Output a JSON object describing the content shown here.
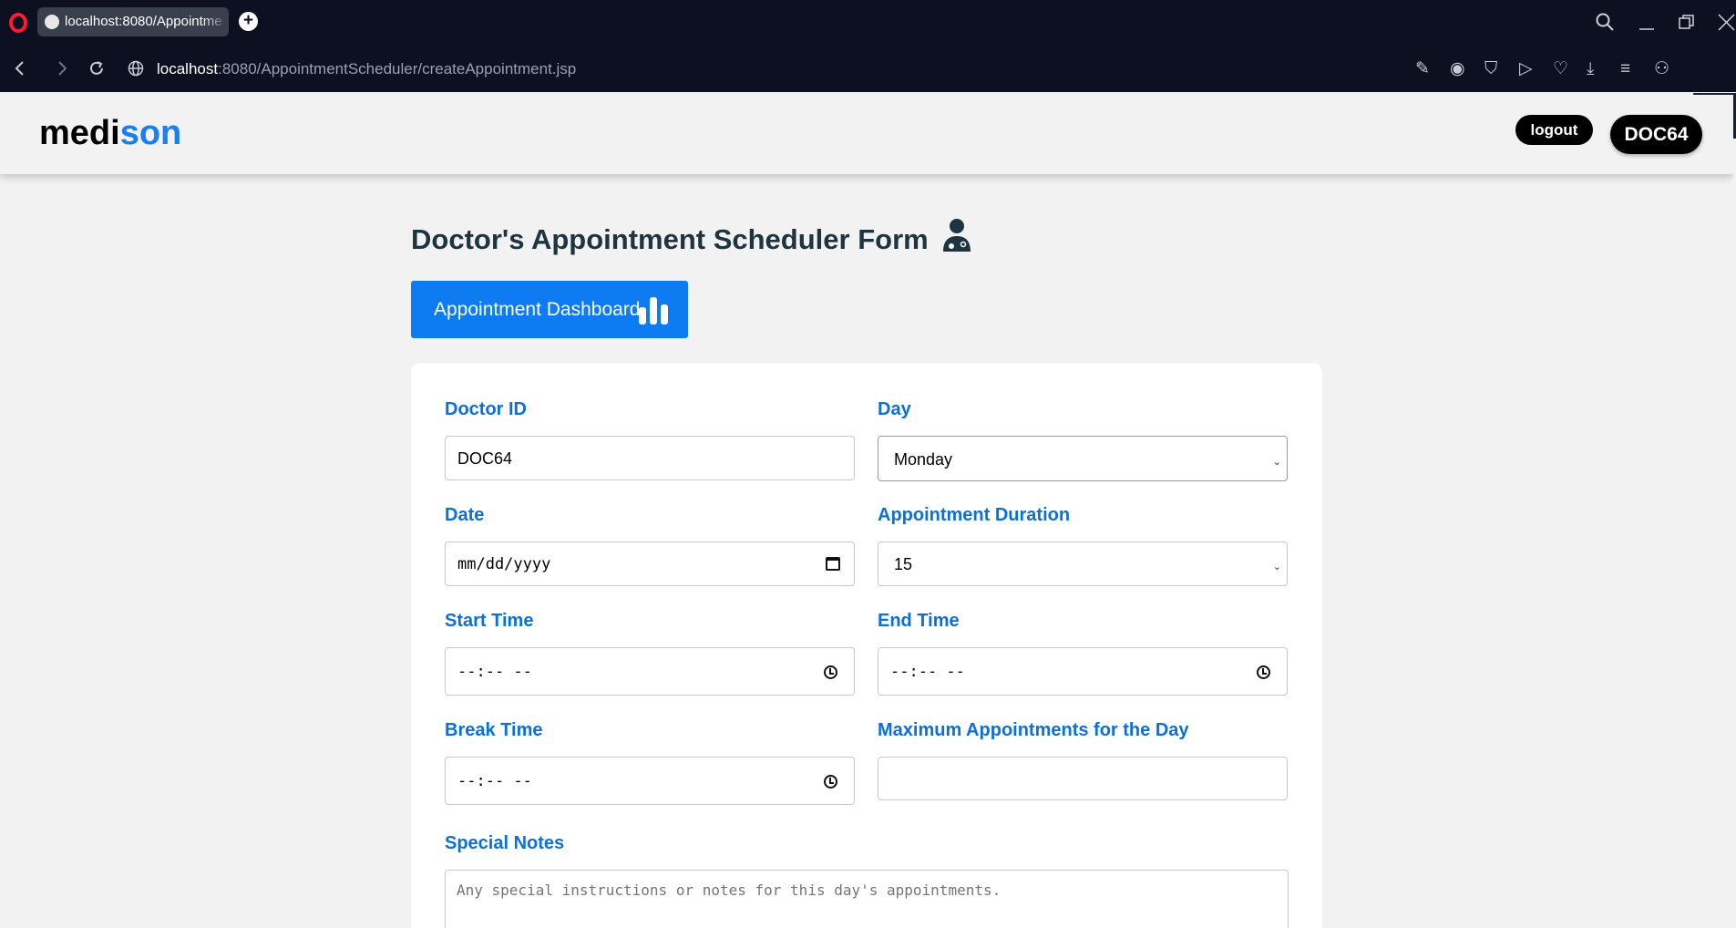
{
  "browser": {
    "tab_title": "localhost:8080/Appointme",
    "new_tab_symbol": "+",
    "url_host": "localhost",
    "url_rest": ":8080/AppointmentScheduler/createAppointment.jsp"
  },
  "header": {
    "brand_part1": "medi",
    "brand_part2": "son",
    "logout_label": "logout",
    "user_badge": "DOC64"
  },
  "page": {
    "title": "Doctor's Appointment Scheduler Form",
    "dashboard_button": "Appointment Dashboard"
  },
  "form": {
    "doctor_id": {
      "label": "Doctor ID",
      "value": "DOC64"
    },
    "day": {
      "label": "Day",
      "value": "Monday"
    },
    "date": {
      "label": "Date",
      "value": "mm/dd/yyyy"
    },
    "duration": {
      "label": "Appointment Duration",
      "value": "15"
    },
    "start_time": {
      "label": "Start Time",
      "value": "--:-- --"
    },
    "end_time": {
      "label": "End Time",
      "value": "--:-- --"
    },
    "break_time": {
      "label": "Break Time",
      "value": "--:-- --"
    },
    "max_appointments": {
      "label": "Maximum Appointments for the Day",
      "value": ""
    },
    "special_notes": {
      "label": "Special Notes",
      "placeholder": "Any special instructions or notes for this day's appointments."
    }
  },
  "colors": {
    "accent": "#0d7cf2",
    "label": "#0d6fd9",
    "title": "#1e3440",
    "browser_chrome": "#0c1020"
  },
  "icons": [
    "opera-logo",
    "globe-icon",
    "back-icon",
    "forward-icon",
    "reload-icon",
    "search-icon",
    "minimize-icon",
    "restore-icon",
    "close-icon",
    "doctor-icon",
    "bar-chart-icon",
    "calendar-icon",
    "clock-icon",
    "chevron-down-icon"
  ]
}
